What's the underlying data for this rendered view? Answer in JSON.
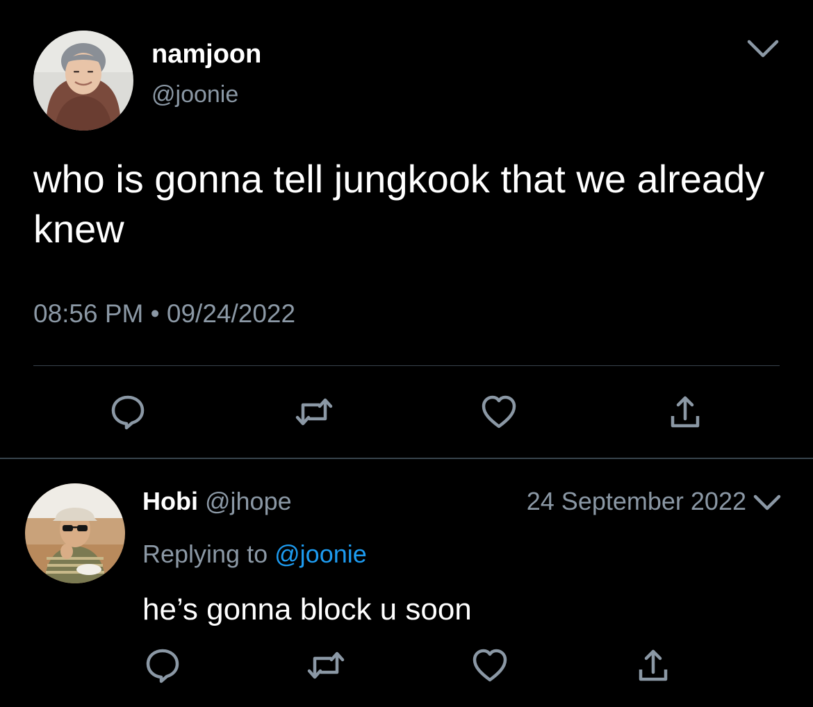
{
  "tweet": {
    "author": {
      "display_name": "namjoon",
      "handle": "@joonie",
      "avatar_icon": "profile-photo"
    },
    "text": "who is gonna tell jungkook that we already knew",
    "time": "08:56 PM",
    "separator": "•",
    "date": "09/24/2022",
    "actions": [
      "reply-icon",
      "retweet-icon",
      "like-icon",
      "share-icon"
    ]
  },
  "reply": {
    "author": {
      "display_name": "Hobi",
      "handle": "@jhope",
      "avatar_icon": "profile-photo"
    },
    "date": "24 September 2022",
    "replying_prefix": "Replying to",
    "replying_to": "@joonie",
    "text": "he’s gonna block u soon",
    "actions": [
      "reply-icon",
      "retweet-icon",
      "like-icon",
      "share-icon"
    ]
  },
  "colors": {
    "background": "#000000",
    "primary_text": "#ffffff",
    "secondary_text": "#8b98a5",
    "link": "#1d9bf0",
    "divider": "#38444d",
    "icon": "#8b98a5"
  }
}
